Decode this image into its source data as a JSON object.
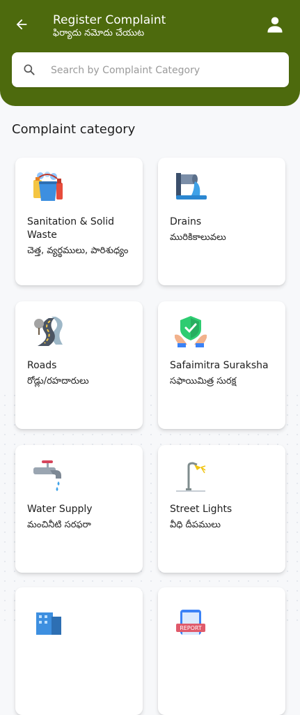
{
  "header": {
    "title": "Register Complaint",
    "subtitle": "ఫిర్యాదు నమోదు చేయుట",
    "back_icon": "arrow-left-icon",
    "profile_icon": "person-icon",
    "bg_color": "#4d6a0d"
  },
  "search": {
    "placeholder": "Search by Complaint Category",
    "icon": "search-icon"
  },
  "section_title": "Complaint category",
  "categories": [
    {
      "en": "Sanitation & Solid Waste",
      "te": "చెత్త, వ్యర్థములు, పారిశుధ్యం",
      "icon": "sanitation-icon"
    },
    {
      "en": "Drains",
      "te": "మురికికాలువలు",
      "icon": "drain-icon"
    },
    {
      "en": "Roads",
      "te": "రోడ్లు/రహదారులు",
      "icon": "road-icon"
    },
    {
      "en": "Safaimitra Suraksha",
      "te": "సఫాయిమిత్ర సురక్ష",
      "icon": "shield-hands-icon"
    },
    {
      "en": "Water Supply",
      "te": "మంచినీటి సరఫరా",
      "icon": "water-tap-icon"
    },
    {
      "en": "Street Lights",
      "te": "వీధి దీపములు",
      "icon": "street-light-icon"
    },
    {
      "en": "",
      "te": "",
      "icon": "building-icon"
    },
    {
      "en": "",
      "te": "",
      "icon": "report-phone-icon",
      "badge": "REPORT"
    }
  ]
}
